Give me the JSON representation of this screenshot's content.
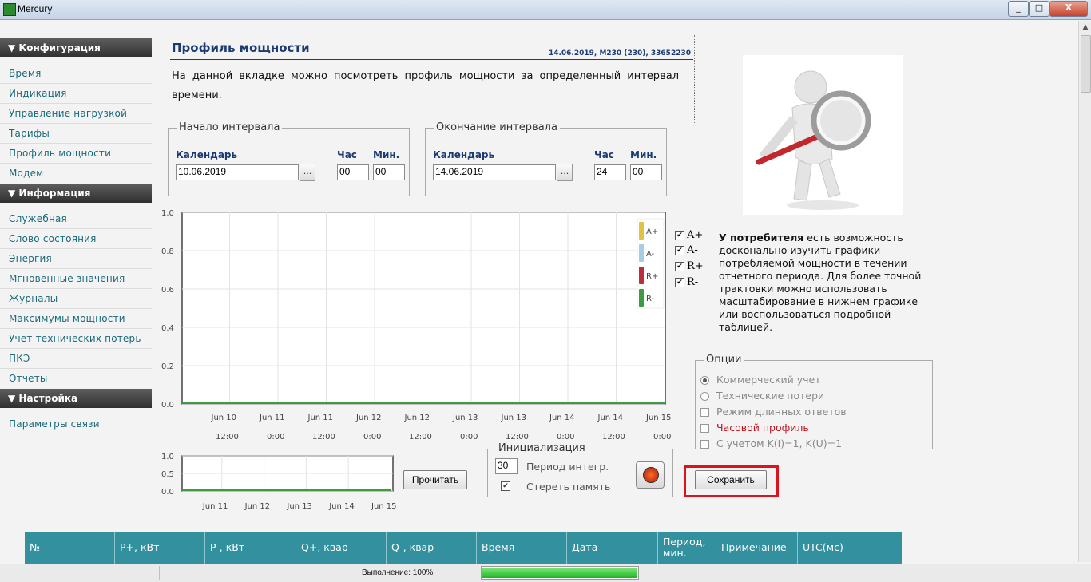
{
  "window": {
    "title": "Mercury",
    "min_label": "_",
    "max_label": "□",
    "close_label": "X"
  },
  "sidebar": {
    "sections": [
      {
        "title": "▼ Конфигурация",
        "items": [
          "Время",
          "Индикация",
          "Управление нагрузкой",
          "Тарифы",
          "Профиль мощности",
          "Модем"
        ]
      },
      {
        "title": "▼ Информация",
        "items": [
          "Служебная",
          "Слово состояния",
          "Энергия",
          "Мгновенные значения",
          "Журналы",
          "Максимумы мощности",
          "Учет технических потерь",
          "ПКЭ",
          "Отчеты"
        ]
      },
      {
        "title": "▼ Настройка",
        "items": [
          "Параметры связи"
        ]
      }
    ]
  },
  "page": {
    "title": "Профиль мощности",
    "meta": "14.06.2019, М230 (230), 33652230",
    "description": "На данной вкладке можно посмотреть профиль мощности за определенный интервал времени."
  },
  "interval_start": {
    "legend": "Начало интервала",
    "calendar_label": "Календарь",
    "hour_label": "Час",
    "min_label": "Мин.",
    "date": "10.06.2019",
    "hour": "00",
    "minute": "00",
    "picker_label": "..."
  },
  "interval_end": {
    "legend": "Окончание интервала",
    "calendar_label": "Календарь",
    "hour_label": "Час",
    "min_label": "Мин.",
    "date": "14.06.2019",
    "hour": "24",
    "minute": "00",
    "picker_label": "..."
  },
  "chart_data": [
    {
      "type": "line",
      "title": "",
      "xlabel": "",
      "ylabel": "",
      "ylim": [
        0,
        1.0
      ],
      "y_ticks": [
        "1.0",
        "0.8",
        "0.6",
        "0.4",
        "0.2",
        "0.0"
      ],
      "x_ticks": [
        [
          "Jun 10",
          "12:00"
        ],
        [
          "Jun 11",
          "0:00"
        ],
        [
          "Jun 11",
          "12:00"
        ],
        [
          "Jun 12",
          "0:00"
        ],
        [
          "Jun 12",
          "12:00"
        ],
        [
          "Jun 13",
          "0:00"
        ],
        [
          "Jun 13",
          "12:00"
        ],
        [
          "Jun 14",
          "0:00"
        ],
        [
          "Jun 14",
          "12:00"
        ],
        [
          "Jun 15",
          "0:00"
        ]
      ],
      "grid": true,
      "legend_position": "top-right",
      "series": [
        {
          "name": "A+",
          "color": "#e0c341",
          "values": [
            0,
            0,
            0,
            0,
            0,
            0,
            0,
            0,
            0,
            0
          ]
        },
        {
          "name": "A-",
          "color": "#a9cbe3",
          "values": [
            0,
            0,
            0,
            0,
            0,
            0,
            0,
            0,
            0,
            0
          ]
        },
        {
          "name": "R+",
          "color": "#b8313a",
          "values": [
            0,
            0,
            0,
            0,
            0,
            0,
            0,
            0,
            0,
            0
          ]
        },
        {
          "name": "R-",
          "color": "#3f9b3f",
          "values": [
            0,
            0,
            0,
            0,
            0,
            0,
            0,
            0,
            0,
            0
          ]
        }
      ]
    },
    {
      "type": "line",
      "title": "",
      "ylim": [
        0,
        1.0
      ],
      "y_ticks": [
        "1.0",
        "0.5",
        "0.0"
      ],
      "x_ticks": [
        "Jun 11",
        "Jun 12",
        "Jun 13",
        "Jun 14",
        "Jun 15"
      ],
      "grid": true,
      "series": [
        {
          "color": "#3f9b3f",
          "values": [
            0,
            0,
            0,
            0,
            0
          ]
        }
      ]
    }
  ],
  "series_checks": [
    {
      "label": "A+",
      "checked": true
    },
    {
      "label": "A-",
      "checked": true
    },
    {
      "label": "R+",
      "checked": true
    },
    {
      "label": "R-",
      "checked": true
    }
  ],
  "info": {
    "bold": "У потребителя",
    "text": " есть возможность досконально изучить графики потребляемой мощности в течении отчетного периода. Для более точной трактовки можно использовать масштабирование в нижнем графике или воспользоваться подробной таблицей."
  },
  "options": {
    "legend": "Опции",
    "commercial": "Коммерческий учет",
    "technical": "Технические потери",
    "long_answers": "Режим длинных ответов",
    "hourly": "Часовой профиль",
    "k_factor": "С учетом K(I)=1, K(U)=1",
    "selected": "commercial"
  },
  "init": {
    "legend": "Инициализация",
    "period_value": "30",
    "period_label": "Период интегр.",
    "erase_label": "Стереть память",
    "erase_checked": true
  },
  "buttons": {
    "read": "Прочитать",
    "save": "Сохранить"
  },
  "table": {
    "headers": [
      "№",
      "P+, кВт",
      "P-, кВт",
      "Q+, квар",
      "Q-, квар",
      "Время",
      "Дата",
      "Период, мин.",
      "Примечание",
      "UTC(мс)"
    ]
  },
  "status": {
    "label": "Выполнение: 100%",
    "progress": 1.0
  },
  "colors": {
    "accent": "#1c3b75",
    "link": "#1a6a7a",
    "table_header": "#33909f",
    "highlight": "#d9141c"
  }
}
